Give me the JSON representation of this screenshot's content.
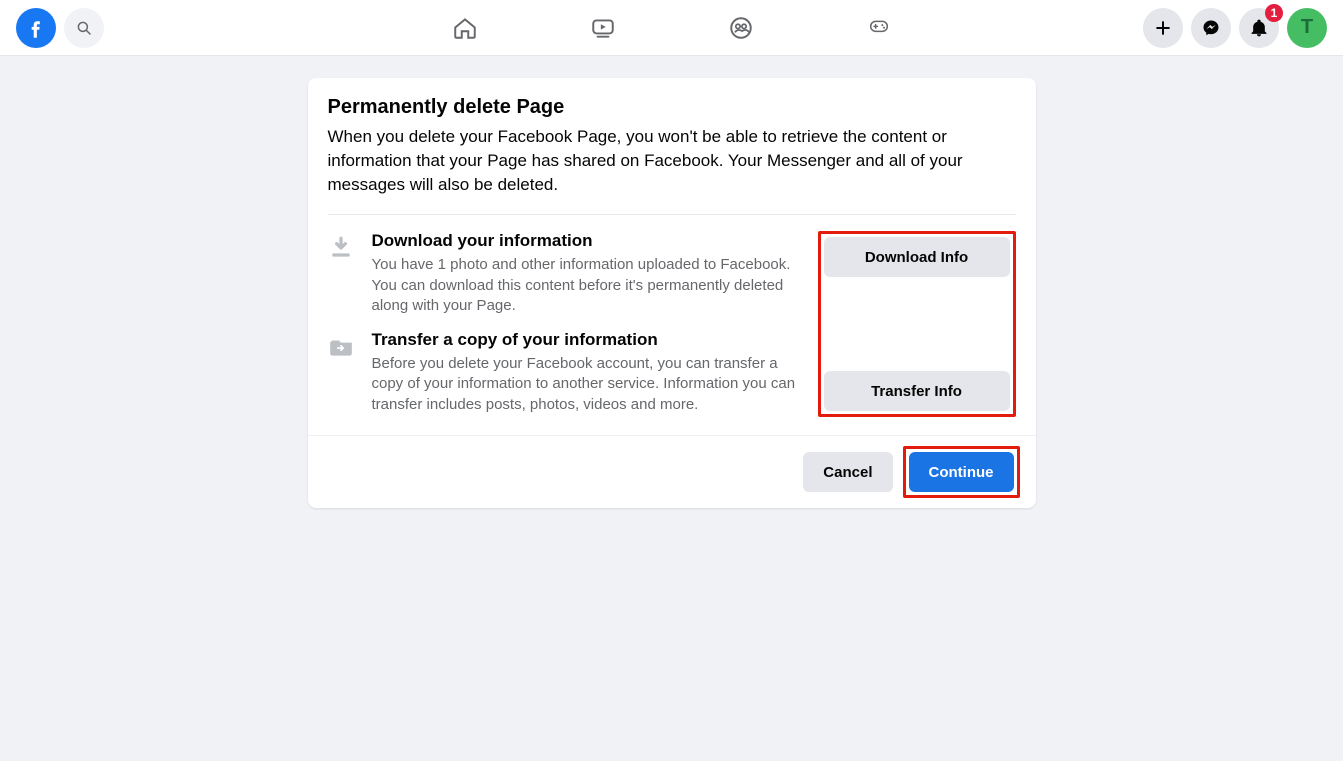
{
  "header": {
    "notifications_count": "1",
    "avatar_initial": "T"
  },
  "dialog": {
    "title": "Permanently delete Page",
    "description": "When you delete your Facebook Page, you won't be able to retrieve the content or information that your Page has shared on Facebook. Your Messenger and all of your messages will also be deleted.",
    "download": {
      "title": "Download your information",
      "description": "You have 1 photo and other information uploaded to Facebook. You can download this content before it's permanently deleted along with your Page.",
      "button": "Download Info"
    },
    "transfer": {
      "title": "Transfer a copy of your information",
      "description": "Before you delete your Facebook account, you can transfer a copy of your information to another service. Information you can transfer includes posts, photos, videos and more.",
      "button": "Transfer Info"
    },
    "cancel_label": "Cancel",
    "continue_label": "Continue"
  }
}
